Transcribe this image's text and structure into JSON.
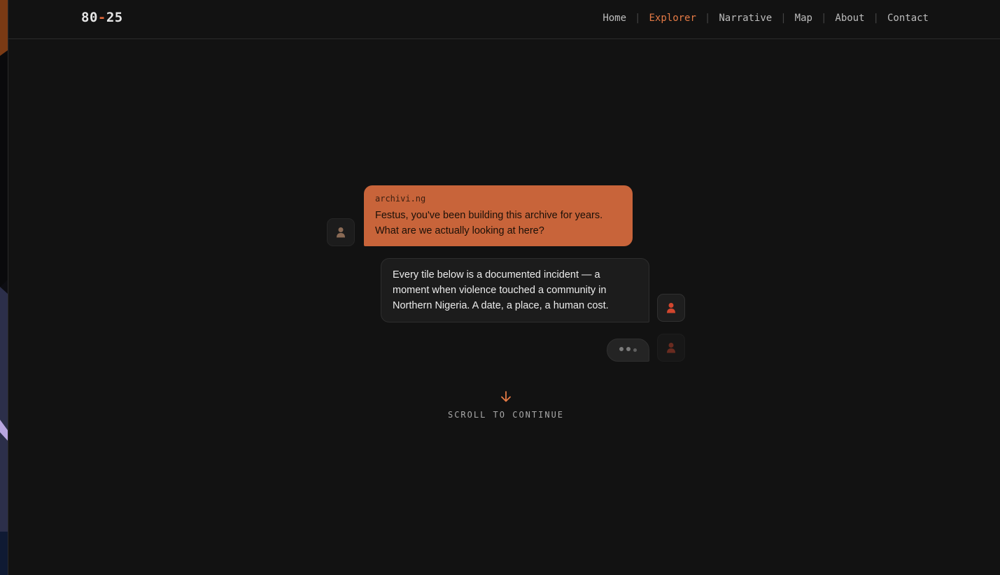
{
  "nav": {
    "logo_left": "80",
    "logo_dash": "-",
    "logo_right": "25",
    "items": [
      {
        "label": "Home"
      },
      {
        "label": "Explorer"
      },
      {
        "label": "Narrative"
      },
      {
        "label": "Map"
      },
      {
        "label": "About"
      },
      {
        "label": "Contact"
      }
    ],
    "active_item": "Explorer"
  },
  "chat": {
    "messages": [
      {
        "sender": "archivi.ng",
        "text": "Festus, you've been building this archive for years. What are we actually looking at here?"
      },
      {
        "text": "Every tile below is a documented incident — a moment when violence touched a community in Northern Nigeria. A date, a place, a human cost."
      }
    ],
    "typing_icon": "typing-dots-icon"
  },
  "scroll": {
    "label": "SCROLL TO CONTINUE",
    "icon": "arrow-down-icon"
  },
  "colors": {
    "accent": "#e57a45",
    "bubble_orange": "#c8643a",
    "background": "#121212",
    "bubble_dark": "#1c1c1c"
  }
}
